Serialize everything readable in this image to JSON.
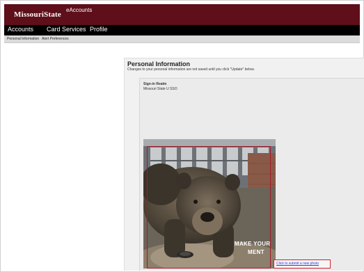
{
  "header": {
    "logo": "MissouriState",
    "app_name": "eAccounts"
  },
  "main_nav": {
    "items": [
      "Accounts",
      "Card Services",
      "Profile"
    ]
  },
  "sub_nav": {
    "items": [
      "Personal Information",
      "Alert Preferences"
    ]
  },
  "main": {
    "title": "Personal Information",
    "subtitle": "Changes to your personal information are not saved until you click \"Update\" below.",
    "sign_in_realm": {
      "label": "Sign-in Realm",
      "value": "Missouri State U SSO"
    },
    "photo": {
      "caption_line1": "MAKE YOUR",
      "caption_line2": "MENT",
      "submit_link": "Click to submit a new photo"
    }
  },
  "colors": {
    "brand_maroon": "#5e0f1a",
    "nav_black": "#000000",
    "highlight_red": "#d0202a",
    "link_blue": "#2b3ed6"
  }
}
